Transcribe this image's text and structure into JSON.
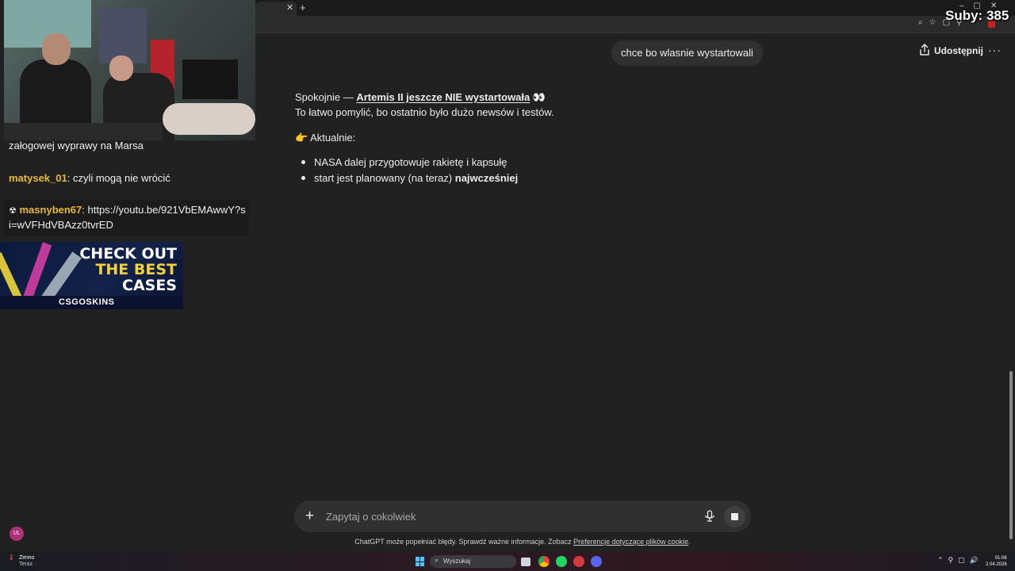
{
  "overlay": {
    "subs_counter": "Suby: 385",
    "chat": [
      {
        "user": "",
        "text": "załogowej wyprawy na Marsa"
      },
      {
        "user": "matysek_01",
        "text": "czyli mogą nie wrócić"
      },
      {
        "user": "masnyben67",
        "text": "https://youtu.be/921VbEMAwwY?si=wVFHdVBAzz0tvrED"
      }
    ],
    "promo": {
      "line1": "CHECK OUT",
      "line2": "THE BEST",
      "line3": "CASES",
      "brand": "CSGOSKINS"
    },
    "avatar_initials": "UL"
  },
  "chatgpt": {
    "user_message": "chce bo wlasnie wystartowali",
    "share_label": "Udostępnij",
    "more_label": "···",
    "answer": {
      "intro_prefix": "Spokojnie — ",
      "intro_bold": "Artemis II jeszcze NIE wystartowała",
      "intro_emoji": "👀",
      "line2": "To łatwo pomylić, bo ostatnio było dużo newsów i testów.",
      "section_emoji": "👉",
      "section_label": "Aktualnie:",
      "bullets": [
        {
          "text": "NASA dalej przygotowuje rakietę i kapsułę",
          "bold": ""
        },
        {
          "text": "start jest planowany (na teraz) ",
          "bold": "najwcześniej"
        }
      ]
    },
    "composer": {
      "placeholder": "Zapytaj o cokolwiek"
    },
    "disclaimer_text": "ChatGPT może popełniać błędy. Sprawdź ważne informacje. Zobacz ",
    "disclaimer_link": "Preferencje dotyczące plików cookie",
    "disclaimer_end": "."
  },
  "taskbar": {
    "weather_title": "Zimno",
    "weather_sub": "Teraz",
    "search_label": "Wyszukaj",
    "time": "01:06",
    "date": "2.04.2026"
  },
  "icons": {
    "share": "upload-share-icon",
    "mic": "microphone-icon",
    "stop": "stop-icon",
    "plus": "plus-icon"
  },
  "colors": {
    "background": "#212121",
    "bubble": "#303030",
    "chat_username": "#e8b93a",
    "win_accent": "#4cc2ff"
  }
}
